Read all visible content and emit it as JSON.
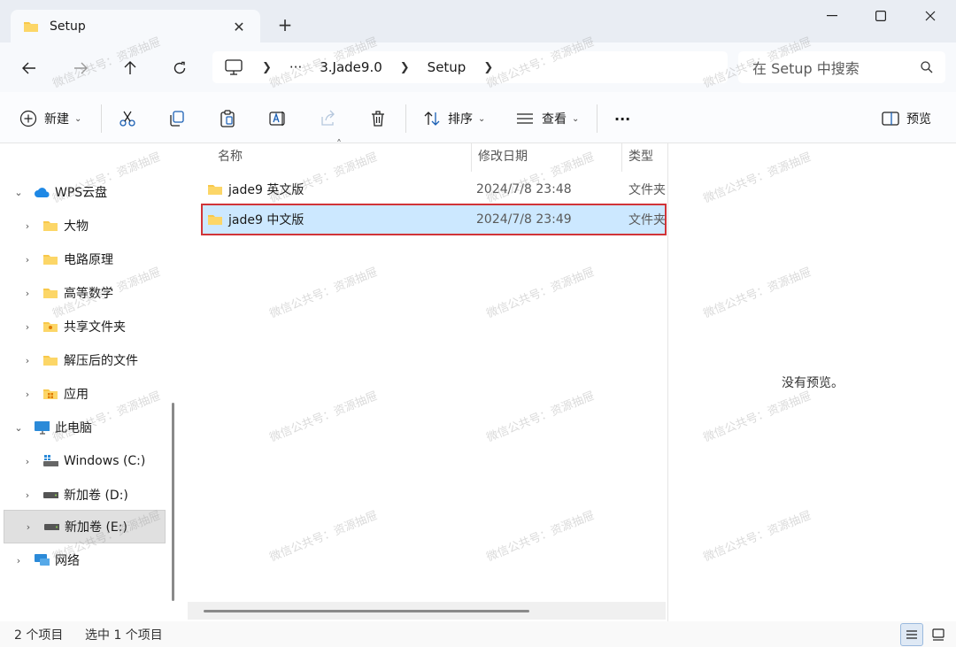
{
  "tab": {
    "title": "Setup"
  },
  "address": {
    "segments": [
      "3.Jade9.0",
      "Setup"
    ],
    "ellipsis": "···"
  },
  "search": {
    "placeholder": "在 Setup 中搜索"
  },
  "commands": {
    "new": "新建",
    "sort": "排序",
    "view": "查看",
    "more": "···",
    "preview": "预览"
  },
  "sidebar": {
    "items": [
      {
        "label": "WPS云盘"
      },
      {
        "label": "大物"
      },
      {
        "label": "电路原理"
      },
      {
        "label": "高等数学"
      },
      {
        "label": "共享文件夹"
      },
      {
        "label": "解压后的文件"
      },
      {
        "label": "应用"
      },
      {
        "label": "此电脑"
      },
      {
        "label": "Windows (C:)"
      },
      {
        "label": "新加卷 (D:)"
      },
      {
        "label": "新加卷 (E:)"
      },
      {
        "label": "网络"
      }
    ]
  },
  "columns": {
    "name": "名称",
    "date": "修改日期",
    "type": "类型"
  },
  "files": [
    {
      "name": "jade9 英文版",
      "date": "2024/7/8 23:48",
      "type": "文件夹"
    },
    {
      "name": "jade9 中文版",
      "date": "2024/7/8 23:49",
      "type": "文件夹"
    }
  ],
  "preview_pane": {
    "message": "没有预览。"
  },
  "status": {
    "count": "2 个项目",
    "selected": "选中 1 个项目"
  },
  "watermark": "微信公共号：资源抽屉",
  "colors": {
    "selection": "#cce8ff",
    "highlight_border": "#d13438",
    "folder": "#f8c84a"
  }
}
